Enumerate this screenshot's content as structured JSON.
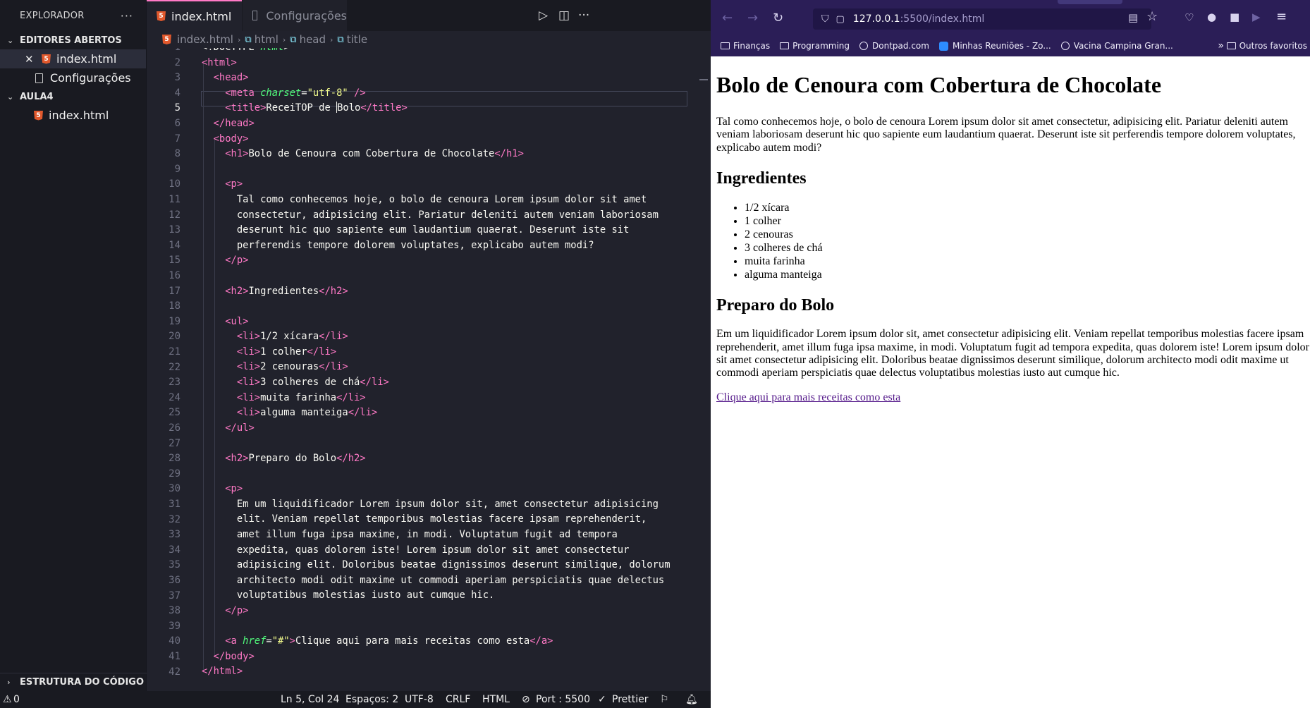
{
  "vscode": {
    "explorer_title": "EXPLORADOR",
    "open_editors_label": "EDITORES ABERTOS",
    "open_editors": [
      {
        "label": "index.html"
      },
      {
        "label": "Configurações"
      }
    ],
    "folder_label": "AULA4",
    "folder_files": [
      {
        "label": "index.html"
      }
    ],
    "outline_label": "ESTRUTURA DO CÓDIGO",
    "tabs": [
      {
        "label": "index.html"
      },
      {
        "label": "Configurações"
      }
    ],
    "breadcrumb": [
      "index.html",
      "html",
      "head",
      "title"
    ],
    "status": {
      "problems": "0",
      "position": "Ln 5, Col 24",
      "spaces": "Espaços: 2",
      "encoding": "UTF-8",
      "eol": "CRLF",
      "language": "HTML",
      "port": "Port : 5500",
      "prettier": "Prettier"
    },
    "line_count": 42,
    "current_line": 5
  },
  "browser": {
    "url_host": "127.0.0.1",
    "url_path": ":5500/index.html",
    "bookmarks": [
      {
        "label": "Finanças",
        "icon": "folder-icon"
      },
      {
        "label": "Programming",
        "icon": "folder-icon"
      },
      {
        "label": "Dontpad.com",
        "icon": "globe-icon"
      },
      {
        "label": "Minhas Reuniões - Zo...",
        "icon": "zoom-icon"
      },
      {
        "label": "Vacina Campina Gran...",
        "icon": "globe-icon"
      }
    ],
    "other_bookmarks": "Outros favoritos",
    "page": {
      "h1": "Bolo de Cenoura com Cobertura de Chocolate",
      "intro": "Tal como conhecemos hoje, o bolo de cenoura Lorem ipsum dolor sit amet consectetur, adipisicing elit. Pariatur deleniti autem veniam laboriosam deserunt hic quo sapiente eum laudantium quaerat. Deserunt iste sit perferendis tempore dolorem voluptates, explicabo autem modi?",
      "h2_ingredients": "Ingredientes",
      "ingredients": [
        "1/2 xícara",
        "1 colher",
        "2 cenouras",
        "3 colheres de chá",
        "muita farinha",
        "alguma manteiga"
      ],
      "h2_preparation": "Preparo do Bolo",
      "preparation": "Em um liquidificador Lorem ipsum dolor sit, amet consectetur adipisicing elit. Veniam repellat temporibus molestias facere ipsam reprehenderit, amet illum fuga ipsa maxime, in modi. Voluptatum fugit ad tempora expedita, quas dolorem iste! Lorem ipsum dolor sit amet consectetur adipisicing elit. Doloribus beatae dignissimos deserunt similique, dolorum architecto modi odit maxime ut commodi aperiam perspiciatis quae delectus voluptatibus molestias iusto aut cumque hic.",
      "link": "Clique aqui para mais receitas como esta"
    }
  }
}
